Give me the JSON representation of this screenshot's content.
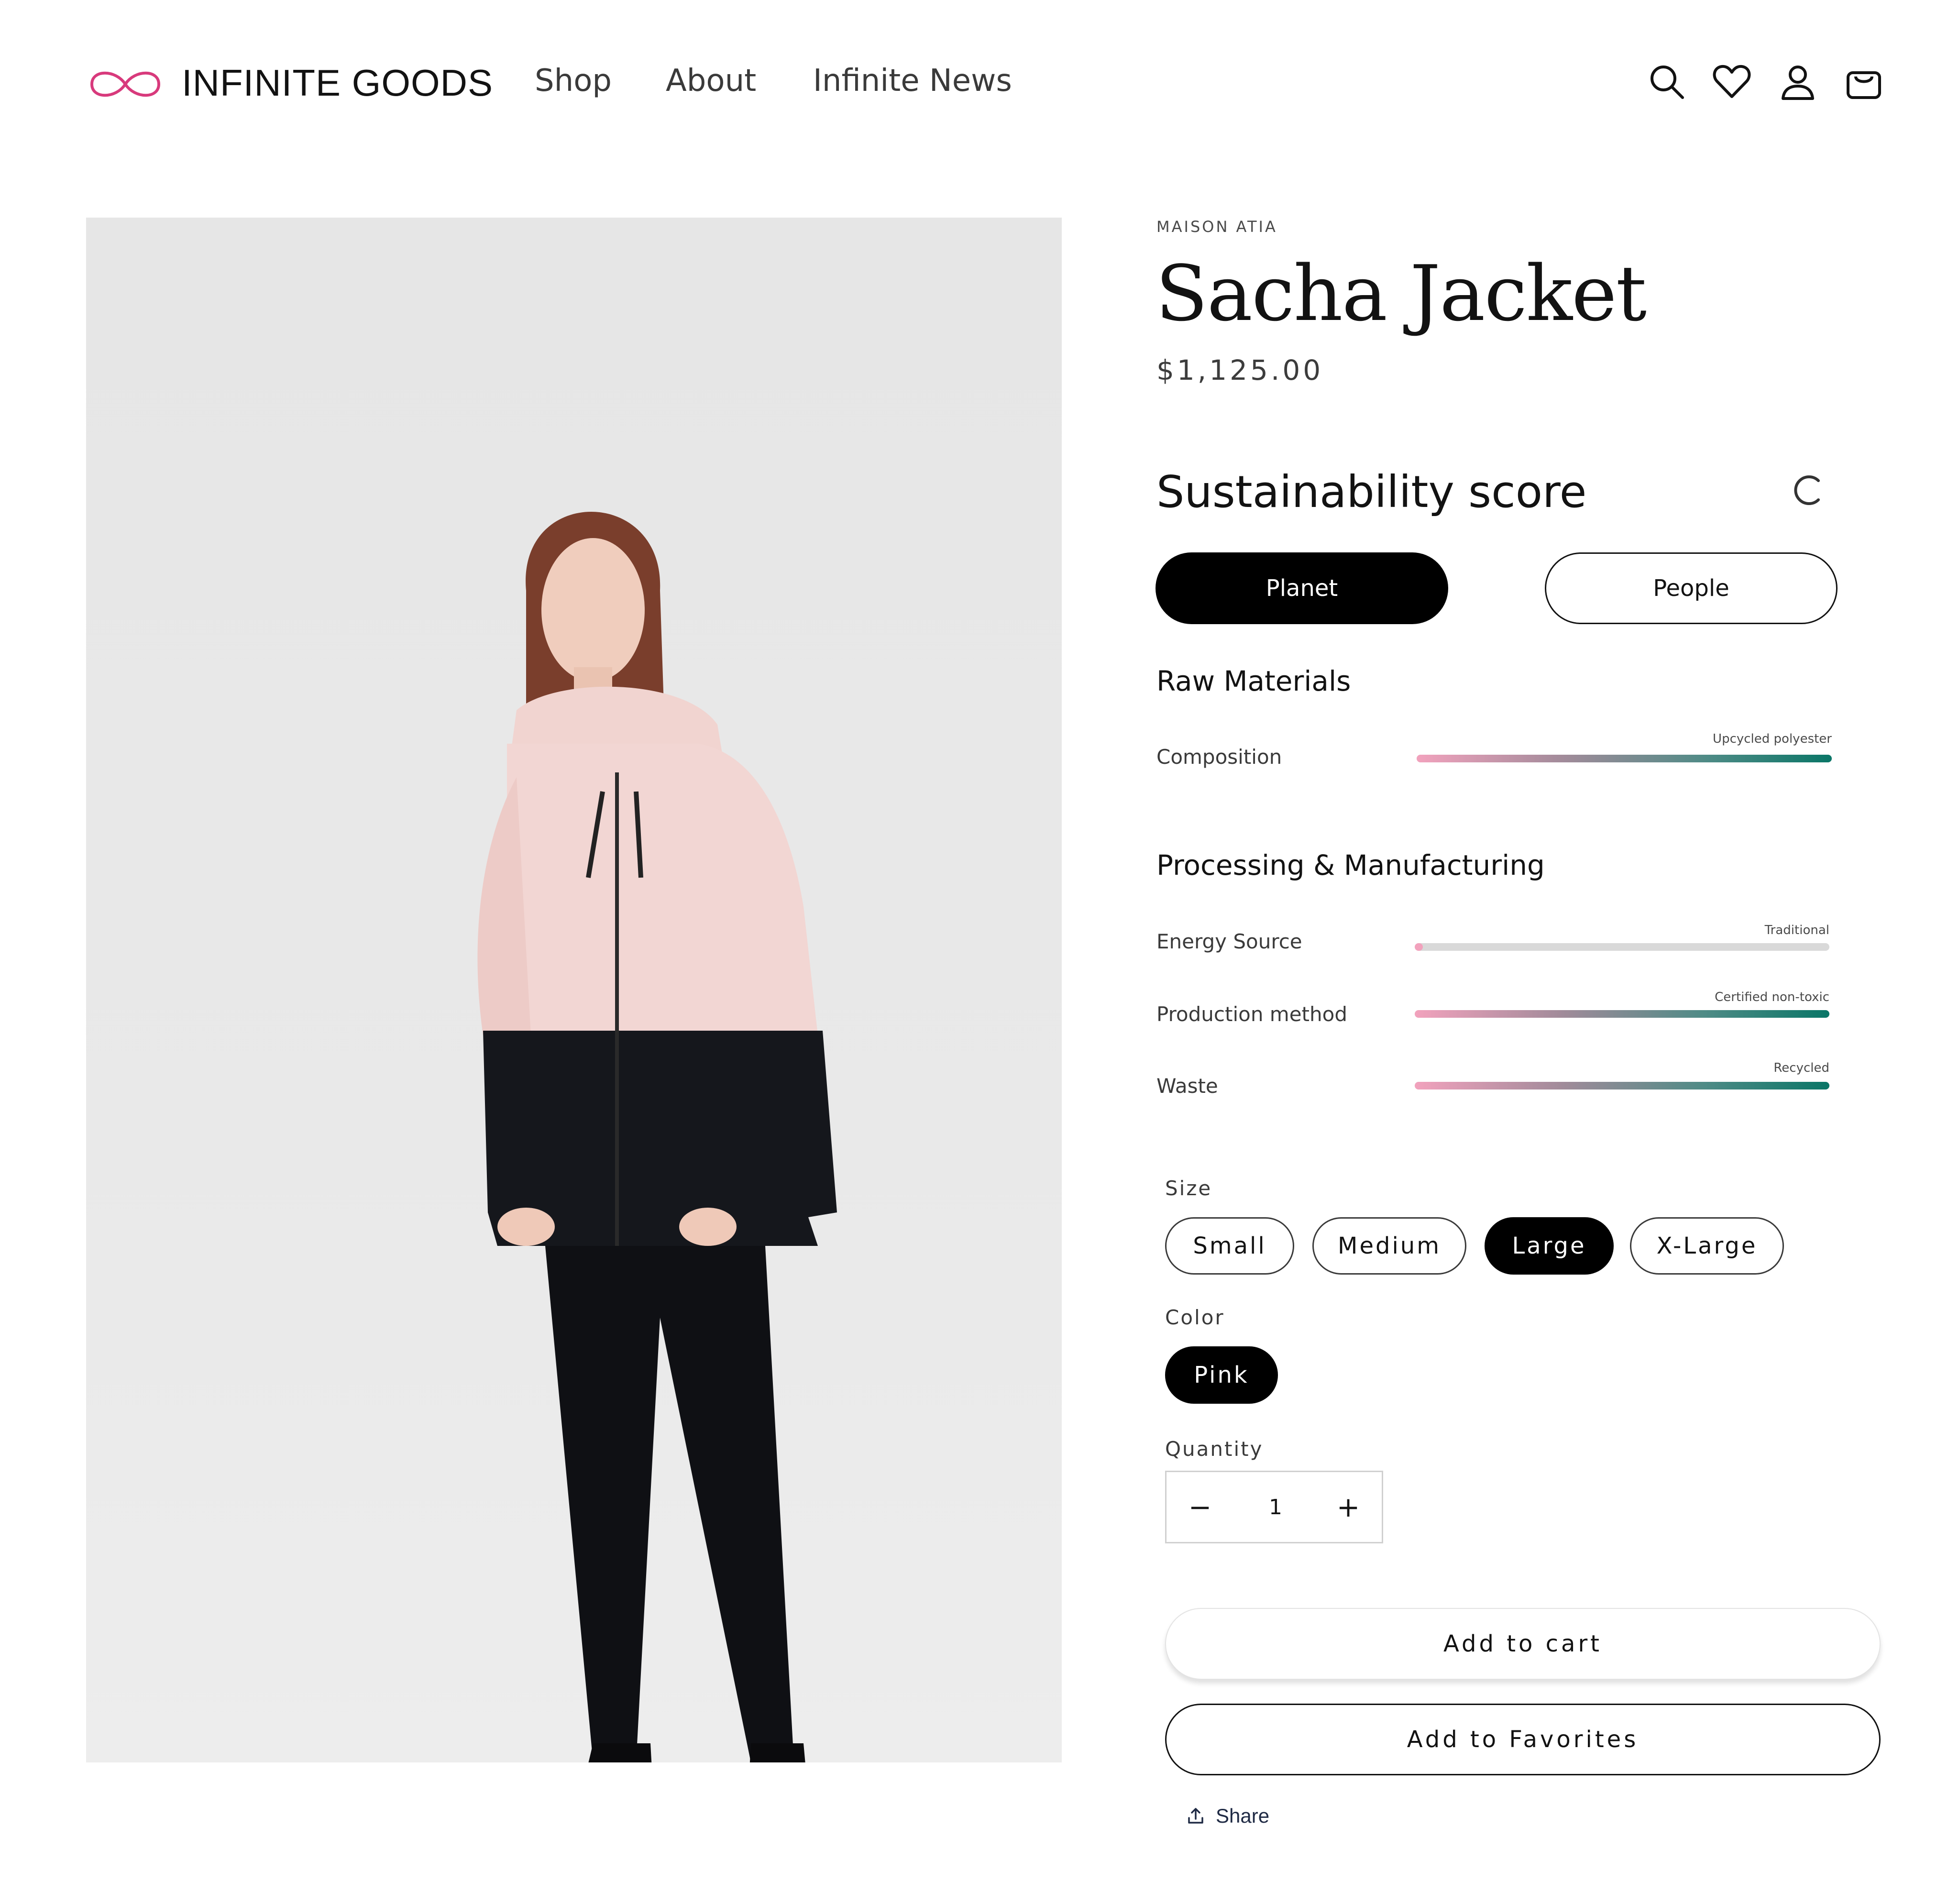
{
  "header": {
    "brand": "INFINITE GOODS",
    "nav": [
      {
        "label": "Shop"
      },
      {
        "label": "About"
      },
      {
        "label": "Infinite News"
      }
    ],
    "icons": [
      "search-icon",
      "heart-icon",
      "account-icon",
      "cart-icon"
    ]
  },
  "product": {
    "vendor": "MAISON ATIA",
    "title": "Sacha Jacket",
    "price": "$1,125.00",
    "image_alt": "Model wearing pink and black hooded jacket"
  },
  "sustainability": {
    "title": "Sustainability score",
    "tabs": [
      {
        "label": "Planet",
        "active": true
      },
      {
        "label": "People",
        "active": false
      }
    ],
    "sections": [
      {
        "heading": "Raw Materials",
        "rows": [
          {
            "label": "Composition",
            "caption": "Upcycled polyester",
            "level": 1.0
          }
        ]
      },
      {
        "heading": "Processing & Manufacturing",
        "rows": [
          {
            "label": "Energy Source",
            "caption": "Traditional",
            "level": 0.02
          },
          {
            "label": "Production method",
            "caption": "Certified non-toxic",
            "level": 1.0
          },
          {
            "label": "Waste",
            "caption": "Recycled",
            "level": 1.0
          }
        ]
      }
    ],
    "colors": {
      "gradient_start": "#f2a2bd",
      "gradient_end": "#0a7667",
      "track": "#d9d9d9"
    }
  },
  "options": {
    "size": {
      "label": "Size",
      "values": [
        "Small",
        "Medium",
        "Large",
        "X-Large"
      ],
      "selected": "Large"
    },
    "color": {
      "label": "Color",
      "values": [
        "Pink"
      ],
      "selected": "Pink"
    }
  },
  "quantity": {
    "label": "Quantity",
    "value": "1",
    "minus": "−",
    "plus": "+"
  },
  "actions": {
    "add_to_cart": "Add to cart",
    "add_to_favorites": "Add to Favorites",
    "share": "Share"
  }
}
